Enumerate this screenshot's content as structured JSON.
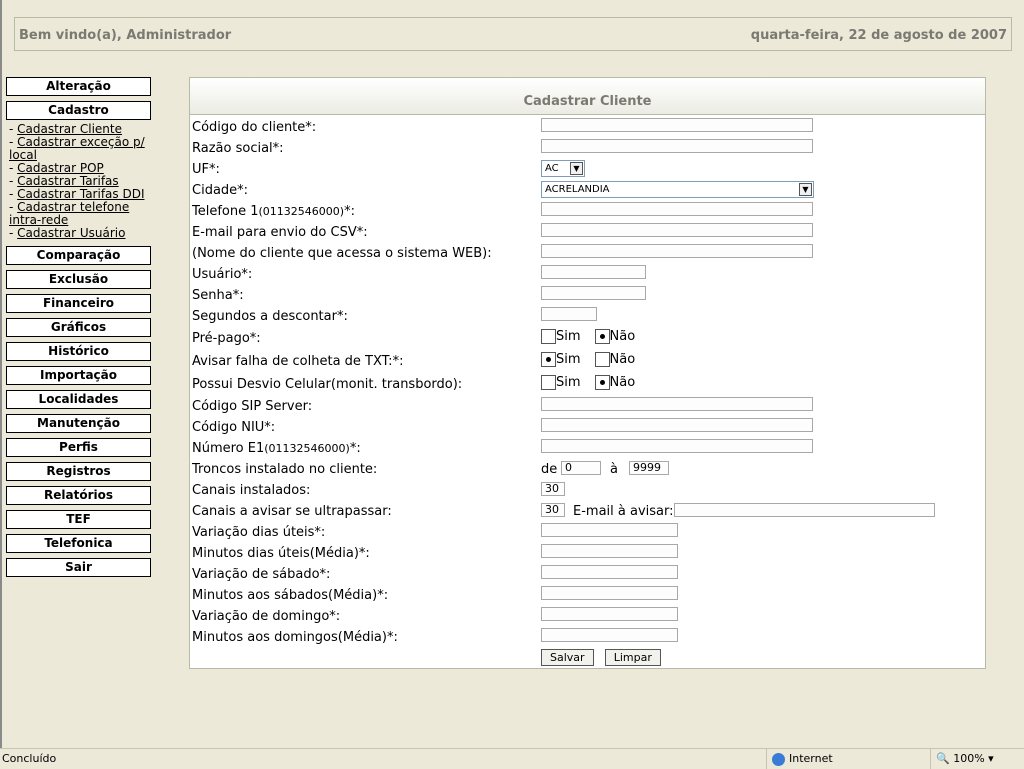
{
  "header": {
    "welcome": "Bem vindo(a), Administrador",
    "date": "quarta-feira, 22 de agosto de 2007"
  },
  "sidebar": {
    "top_items": [
      "Alteração",
      "Cadastro"
    ],
    "cadastro_links": [
      "Cadastrar Cliente",
      "Cadastrar exceção p/ local",
      "Cadastrar POP",
      "Cadastrar Tarifas",
      "Cadastrar Tarifas DDI",
      "Cadastrar telefone intra-rede",
      "Cadastrar Usuário"
    ],
    "items": [
      "Comparação",
      "Exclusão",
      "Financeiro",
      "Gráficos",
      "Histórico",
      "Importação",
      "Localidades",
      "Manutenção",
      "Perfis",
      "Registros",
      "Relatórios",
      "TEF",
      "Telefonica",
      "Sair"
    ]
  },
  "form": {
    "title": "Cadastrar Cliente",
    "labels": {
      "codigo": "Código do cliente*:",
      "razao": "Razão social*:",
      "uf": "UF*:",
      "cidade": "Cidade*:",
      "telefone": "Telefone 1",
      "telefone_hint": "(01132546000)",
      "telefone_suffix": "*:",
      "email_csv": "E-mail para envio do CSV*:",
      "nome_web": "(Nome do cliente que acessa o sistema WEB):",
      "usuario": "Usuário*:",
      "senha": "Senha*:",
      "segundos": "Segundos a descontar*:",
      "prepago": "Pré-pago*:",
      "avisar_falha": "Avisar falha de colheta de TXT:*:",
      "desvio": "Possui Desvio Celular(monit. transbordo):",
      "sip": "Código SIP Server:",
      "niu": "Código NIU*:",
      "e1": "Número E1",
      "e1_hint": "(01132546000)",
      "e1_suffix": "*:",
      "troncos": "Troncos instalado no cliente:",
      "canais": "Canais instalados:",
      "canais_avisar": "Canais a avisar se ultrapassar:",
      "var_uteis": "Variação dias úteis*:",
      "min_uteis": "Minutos dias úteis(Média)*:",
      "var_sabado": "Variação de sábado*:",
      "min_sabado": "Minutos aos sábados(Média)*:",
      "var_domingo": "Variação de domingo*:",
      "min_domingo": "Minutos aos domingos(Média)*:"
    },
    "uf_value": "AC",
    "cidade_value": "ACRELANDIA",
    "sim": "Sim",
    "nao": "Não",
    "troncos_de": "de",
    "troncos_from": "0",
    "troncos_a": "à",
    "troncos_to": "9999",
    "canais_value": "30",
    "canais_avisar_value": "30",
    "email_avisar_label": "E-mail à avisar:",
    "save": "Salvar",
    "clear": "Limpar"
  },
  "status": {
    "left": "Concluído",
    "zone": "Internet",
    "zoom": "100%"
  }
}
